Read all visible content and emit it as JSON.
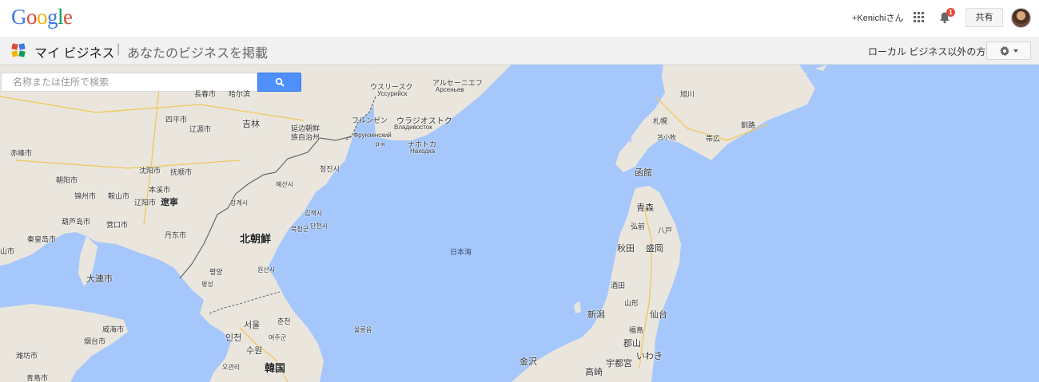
{
  "header": {
    "logo": [
      "G",
      "o",
      "o",
      "g",
      "l",
      "e"
    ],
    "user_link": "+Kenichiさん",
    "notification_count": "1",
    "share_label": "共有"
  },
  "subheader": {
    "title": "マイ ビジネス",
    "separator": "|",
    "subtitle": "あなたのビジネスを掲載",
    "not_local_link": "ローカル ビジネス以外の方"
  },
  "search": {
    "placeholder": "名称または住所で検索"
  },
  "map": {
    "labels": {
      "ussuriisk": "ウスリースク",
      "ussuriisk_ru": "Уссурийск",
      "arsenyev": "アルセーニエフ",
      "arsenyev_ru": "Арсеньев",
      "fenzhen": "フルンゼン",
      "vladivostok": "ウラジオストク",
      "vladivostok_ru": "Владивосток",
      "fenzhen_ru": "Фрунзенский",
      "nakhodka": "ナホトカ",
      "nakhodka_ru": "Находка",
      "rn": "р-н",
      "jilin": "吉林",
      "changchun": "長春市",
      "harbin_area": "哈尔滨",
      "siping": "四平市",
      "liaoyuan": "辽源市",
      "yanji": "延边朝鲜族自治州",
      "chifeng": "赤峰市",
      "shenyang": "沈阳市",
      "fushun": "抚顺市",
      "chaoyang": "朝阳市",
      "benxi": "本溪市",
      "jinzhou": "锦州市",
      "anshan": "鞍山市",
      "liaoyang": "辽阳市",
      "liaoning": "遼寧",
      "huludao": "葫芦岛市",
      "yingkou": "营口市",
      "qinhuangdao": "秦皇岛市",
      "dalian": "大連市",
      "dandong": "丹东市",
      "chongjin": "청진시",
      "hyesan": "혜산시",
      "kanggye": "강계시",
      "kimchaek": "김책시",
      "bukcheong": "북청군",
      "danchon": "단천시",
      "north_korea": "北朝鮮",
      "pyongyang": "평양",
      "wonsan": "원산시",
      "pyongsan": "평성",
      "seoul": "서울",
      "chuncheon": "춘천",
      "incheon": "인천",
      "suwon": "수원",
      "yeoju": "여주군",
      "korea": "韓国",
      "okcheon": "오관리",
      "ulleung": "울릉읍",
      "sea_of_japan": "日本海",
      "weihai": "威海市",
      "yantai": "烟台市",
      "weifang": "潍坊市",
      "qingdao": "青島市",
      "yangshan": "山市",
      "asahikawa": "旭川",
      "sapporo": "札幌",
      "tomakomai": "苫小牧",
      "obihiro": "帯広",
      "kushiro": "釧路",
      "hakodate": "函館",
      "aomori": "青森",
      "hirosaki": "弘前",
      "hachinohe": "八戸",
      "akita": "秋田",
      "morioka": "盛岡",
      "yamagata": "山形",
      "sakata": "酒田",
      "sendai": "仙台",
      "niigata": "新潟",
      "fukushima": "福島",
      "koriyama": "郡山",
      "iwaki": "いわき",
      "kanazawa": "金沢",
      "takasaki": "高崎",
      "utsunomiya": "宇都宮"
    }
  },
  "colors": {
    "water": "#a6c7fb",
    "land": "#eae6dd",
    "search_button": "#4d90fe",
    "badge": "#dd4b39"
  }
}
